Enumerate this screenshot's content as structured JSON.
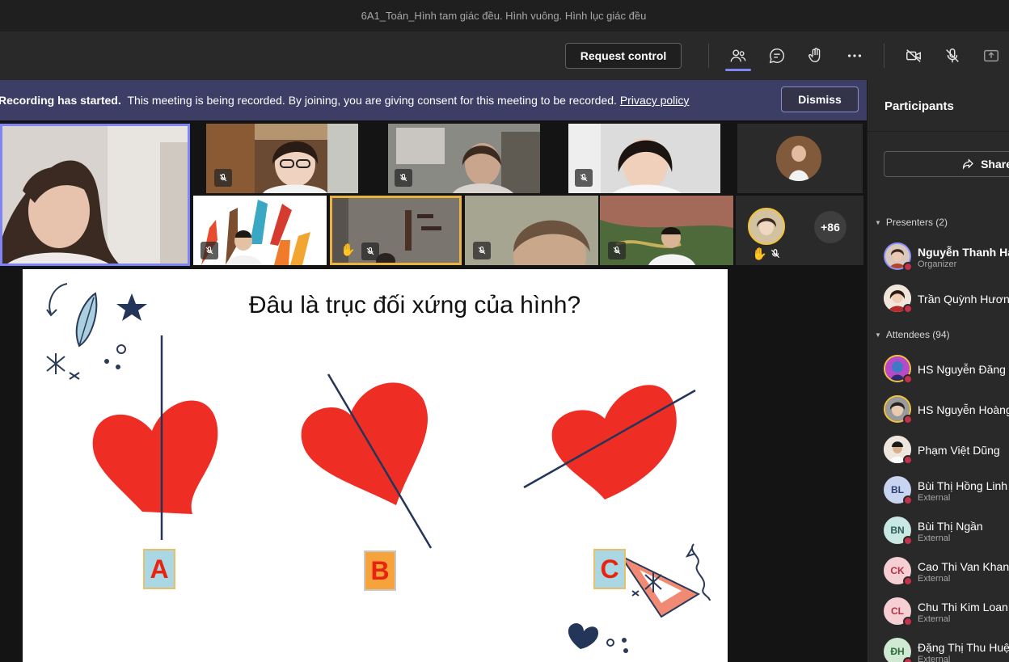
{
  "window": {
    "title": "6A1_Toán_Hình tam giác đều. Hình vuông. Hình lục giác đều"
  },
  "toolbar": {
    "request_control_label": "Request control",
    "icons": [
      "people-icon",
      "chat-icon",
      "raise-hand-icon",
      "more-icon",
      "camera-off-icon",
      "mic-off-icon",
      "share-tray-icon"
    ]
  },
  "banner": {
    "title": "Recording has started.",
    "message": "This meeting is being recorded. By joining, you are giving consent for this meeting to be recorded.",
    "link": "Privacy policy",
    "dismiss_label": "Dismiss"
  },
  "stage": {
    "overflow_count": "+86"
  },
  "slide": {
    "title": "Đâu là trục đối xứng của hình?",
    "options": [
      "A",
      "B",
      "C"
    ]
  },
  "panel": {
    "title": "Participants",
    "share_label": "Share",
    "presenters_header": "Presenters (2)",
    "attendees_header": "Attendees (94)",
    "presenters": [
      {
        "name": "Nguyễn Thanh Hả",
        "sub": "Organizer"
      },
      {
        "name": "Trần Quỳnh Hương",
        "sub": ""
      }
    ],
    "attendees": [
      {
        "name": "HS Nguyễn Đăng N",
        "sub": "",
        "initials": ""
      },
      {
        "name": "HS Nguyễn Hoàng",
        "sub": "",
        "initials": ""
      },
      {
        "name": "Phạm Việt Dũng",
        "sub": "",
        "initials": ""
      },
      {
        "name": "Bùi Thị Hồng Linh",
        "sub": "External",
        "initials": "BL"
      },
      {
        "name": "Bùi Thị Ngần",
        "sub": "External",
        "initials": "BN"
      },
      {
        "name": "Cao Thi Van Khanh",
        "sub": "External",
        "initials": "CK"
      },
      {
        "name": "Chu Thi Kim Loan",
        "sub": "External",
        "initials": "CL"
      },
      {
        "name": "Đặng Thị Thu Huệ",
        "sub": "External",
        "initials": "ĐH"
      }
    ]
  }
}
